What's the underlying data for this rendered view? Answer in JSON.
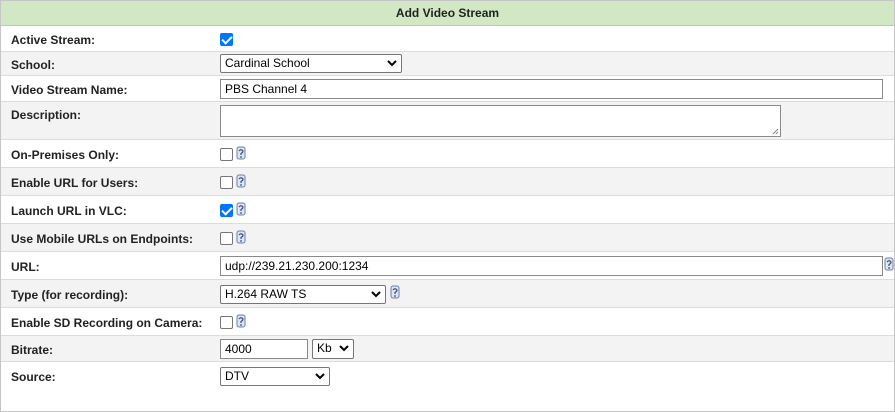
{
  "title": "Add Video Stream",
  "fields": {
    "active_stream": {
      "label": "Active Stream:",
      "checked": true
    },
    "school": {
      "label": "School:",
      "value": "Cardinal School"
    },
    "name": {
      "label": "Video Stream Name:",
      "value": "PBS Channel 4"
    },
    "description": {
      "label": "Description:",
      "value": ""
    },
    "on_premises": {
      "label": "On-Premises Only:",
      "checked": false
    },
    "enable_url": {
      "label": "Enable URL for Users:",
      "checked": false
    },
    "launch_vlc": {
      "label": "Launch URL in VLC:",
      "checked": true
    },
    "mobile_urls": {
      "label": "Use Mobile URLs on Endpoints:",
      "checked": false
    },
    "url": {
      "label": "URL:",
      "value": "udp://239.21.230.200:1234"
    },
    "type": {
      "label": "Type (for recording):",
      "value": "H.264 RAW TS"
    },
    "sd_recording": {
      "label": "Enable SD Recording on Camera:",
      "checked": false
    },
    "bitrate": {
      "label": "Bitrate:",
      "value": "4000",
      "unit": "Kb"
    },
    "source": {
      "label": "Source:",
      "value": "DTV"
    }
  },
  "colors": {
    "header_bg": "#d2e8c4",
    "row_alt_bg": "#f3f3f3",
    "checkbox_checked": "#0075ff"
  },
  "icons": {
    "help": "help-scroll-icon",
    "dropdown": "chevron-down-icon"
  }
}
